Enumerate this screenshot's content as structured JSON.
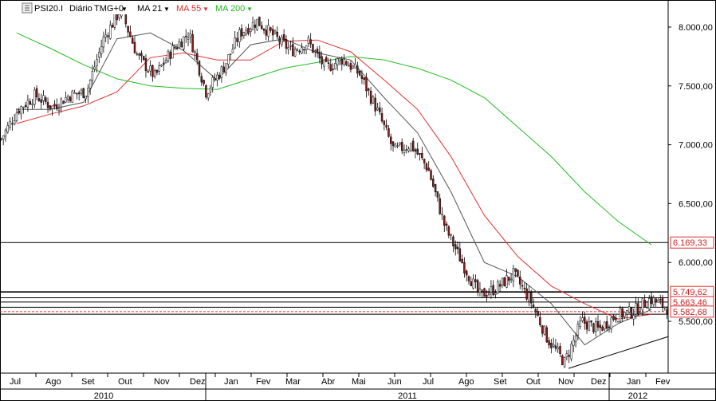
{
  "chart_data": {
    "type": "line",
    "header": {
      "symbol": "PSI20.I",
      "interval": "Diário",
      "timezone": "TMG+0",
      "ma_short_label": "MA 21",
      "ma_mid_label": "MA 55",
      "ma_long_label": "MA 200"
    },
    "x_labels": [
      "Jul",
      "Ago",
      "Set",
      "Out",
      "Nov",
      "Dez",
      "Jan",
      "Fev",
      "Mar",
      "Abr",
      "Mai",
      "Jun",
      "Jul",
      "Ago",
      "Set",
      "Out",
      "Nov",
      "Dez",
      "Jan",
      "Fev"
    ],
    "years": [
      "2010",
      "2011",
      "2012"
    ],
    "y_ticks": [
      "8.000,00",
      "7.500,00",
      "7.000,00",
      "6.500,00",
      "6.000,00",
      "5.500,00"
    ],
    "y_tick_values": [
      8000,
      7500,
      7000,
      6500,
      6000,
      5500
    ],
    "ylim": [
      5060,
      8230
    ],
    "grid": false,
    "legend_position": "top-left",
    "colors": {
      "ma21": "#555555",
      "ma55": "#e03030",
      "ma200": "#22bb22",
      "bull_candle": "#ffffff",
      "bear_candle": "#8b1a1a",
      "price_tag_border": "#e03030",
      "price_tag_text": "#cc2222"
    },
    "price_labels": [
      "6.169,33",
      "5.749,62",
      "5.663,46",
      "5.582,68"
    ],
    "horizontal_levels": [
      6169.33,
      5749.62,
      5700,
      5663.46,
      5620,
      5582.68,
      5560
    ],
    "trendline": {
      "from": [
        "Nov 2011",
        5100
      ],
      "to": [
        "Fev 2012",
        5370
      ]
    },
    "series": [
      {
        "name": "PSI20.I",
        "close_anchors": [
          [
            "Jul 2010",
            7050
          ],
          [
            "Jul 2010 late",
            7300
          ],
          [
            "Ago 2010",
            7420
          ],
          [
            "Ago 2010 late",
            7320
          ],
          [
            "Set 2010",
            7420
          ],
          [
            "Set 2010 late",
            7450
          ],
          [
            "Out 2010",
            7900
          ],
          [
            "Out 2010 late",
            8150
          ],
          [
            "Nov 2010",
            7750
          ],
          [
            "Nov 2010 late",
            7580
          ],
          [
            "Dez 2010",
            7800
          ],
          [
            "Dez 2010 late",
            7950
          ],
          [
            "Jan 2011",
            7450
          ],
          [
            "Jan 2011 late",
            7650
          ],
          [
            "Fev 2011",
            7950
          ],
          [
            "Fev 2011 late",
            8050
          ],
          [
            "Mar 2011",
            7920
          ],
          [
            "Mar 2011 late",
            7800
          ],
          [
            "Abr 2011",
            7870
          ],
          [
            "Abr 2011 late",
            7650
          ],
          [
            "Mai 2011",
            7730
          ],
          [
            "Mai 2011 late",
            7600
          ],
          [
            "Jun 2011",
            7300
          ],
          [
            "Jun 2011 late",
            6950
          ],
          [
            "Jul 2011",
            7000
          ],
          [
            "Jul 2011 late",
            6800
          ],
          [
            "Ago 2011",
            6300
          ],
          [
            "Ago 2011 late",
            6000
          ],
          [
            "Set 2011",
            5720
          ],
          [
            "Set 2011 late",
            5780
          ],
          [
            "Out 2011",
            5900
          ],
          [
            "Out 2011 late",
            5680
          ],
          [
            "Nov 2011",
            5350
          ],
          [
            "Nov 2011 late",
            5150
          ],
          [
            "Dez 2011",
            5500
          ],
          [
            "Dez 2011 late",
            5430
          ],
          [
            "Jan 2012",
            5550
          ],
          [
            "Jan 2012 late",
            5580
          ],
          [
            "Fev 2012",
            5690
          ],
          [
            "Fev 2012 late",
            5620
          ]
        ]
      },
      {
        "name": "MA 21",
        "values": [
          7300,
          7300,
          7360,
          7900,
          7950,
          7800,
          7550,
          7850,
          7900,
          7780,
          7720,
          7400,
          7100,
          6600,
          6000,
          5880,
          5650,
          5300,
          5480,
          5600
        ]
      },
      {
        "name": "MA 55",
        "values": [
          7180,
          7260,
          7330,
          7450,
          7740,
          7780,
          7720,
          7720,
          7880,
          7890,
          7790,
          7550,
          7300,
          6900,
          6400,
          6050,
          5800,
          5650,
          5520,
          5560
        ]
      },
      {
        "name": "MA 200",
        "values": [
          7950,
          7820,
          7680,
          7560,
          7500,
          7480,
          7470,
          7560,
          7650,
          7700,
          7750,
          7720,
          7650,
          7550,
          7400,
          7150,
          6900,
          6600,
          6350,
          6150
        ]
      }
    ]
  }
}
